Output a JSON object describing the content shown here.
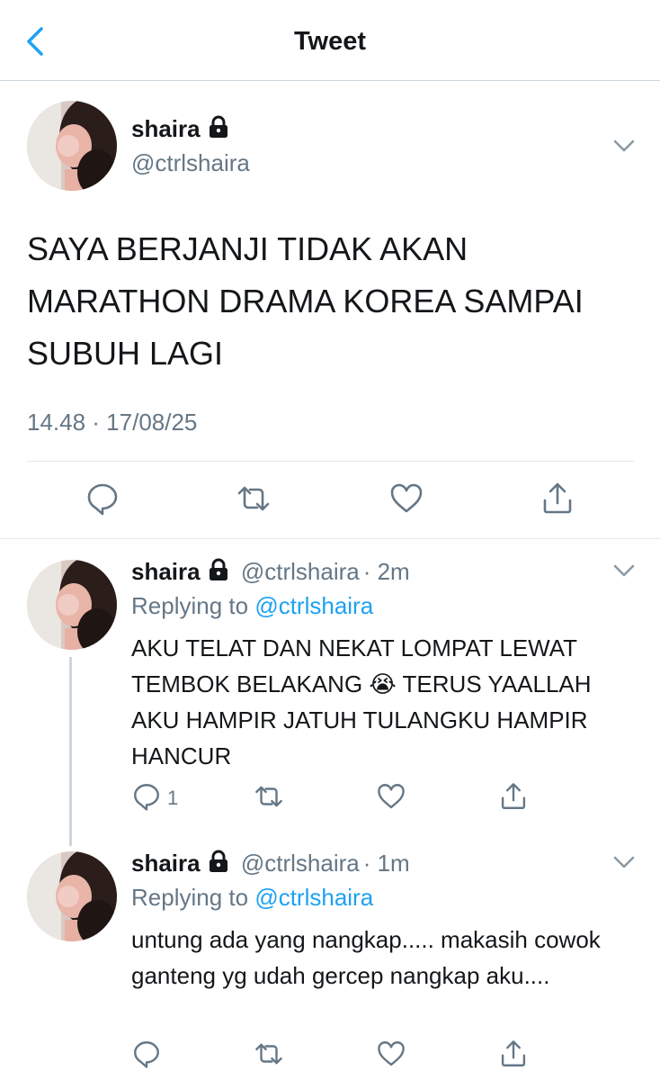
{
  "header": {
    "title": "Tweet"
  },
  "tweet": {
    "name": "shaira",
    "handle": "@ctrlshaira",
    "text": "SAYA BERJANJI TIDAK AKAN MARATHON DRAMA KOREA SAMPAI SUBUH LAGI",
    "timestamp": "14.48 · 17/08/25"
  },
  "replies": [
    {
      "name": "shaira",
      "handle": "@ctrlshaira",
      "time": "· 2m",
      "replying_label": "Replying to",
      "replying_to": "@ctrlshaira",
      "text": "AKU TELAT DAN NEKAT LOMPAT LEWAT TEMBOK BELAKANG 😭 TERUS YAALLAH AKU HAMPIR JATUH TULANGKU HAMPIR HANCUR",
      "reply_count": "1"
    },
    {
      "name": "shaira",
      "handle": "@ctrlshaira",
      "time": "· 1m",
      "replying_label": "Replying to",
      "replying_to": "@ctrlshaira",
      "text": "untung ada yang nangkap..... makasih cowok ganteng yg udah gercep nangkap aku...."
    }
  ],
  "colors": {
    "accent": "#1da1f2",
    "muted": "#657786",
    "divider": "#e1e8ed"
  },
  "icons": [
    "back-chevron-icon",
    "lock-icon",
    "chevron-down-icon",
    "reply-icon",
    "retweet-icon",
    "like-icon",
    "share-icon"
  ]
}
